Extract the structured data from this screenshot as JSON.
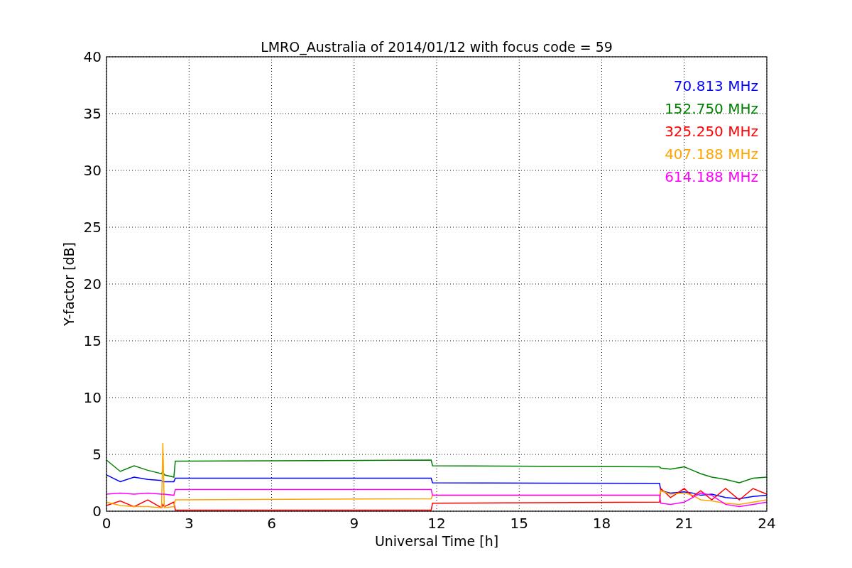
{
  "chart_data": {
    "type": "line",
    "title": "LMRO_Australia of 2014/01/12 with focus code = 59",
    "xlabel": "Universal Time [h]",
    "ylabel": "Y-factor [dB]",
    "x": [
      0,
      0.5,
      1,
      1.5,
      2,
      2.05,
      2.1,
      2.45,
      2.5,
      11.8,
      11.85,
      20.1,
      20.15,
      20.5,
      21,
      21.3,
      21.6,
      22,
      22.5,
      23,
      23.5,
      24
    ],
    "series": [
      {
        "name": "70.813 MHz",
        "color": "#0000ff",
        "values": [
          3.2,
          2.6,
          3.0,
          2.8,
          2.7,
          2.6,
          2.6,
          2.6,
          2.9,
          2.9,
          2.5,
          2.45,
          1.8,
          1.6,
          1.7,
          1.6,
          1.4,
          1.5,
          1.2,
          1.1,
          1.3,
          1.4
        ]
      },
      {
        "name": "152.750 MHz",
        "color": "#008000",
        "values": [
          4.5,
          3.5,
          4.0,
          3.6,
          3.3,
          3.5,
          3.2,
          3.0,
          4.4,
          4.5,
          4.0,
          3.9,
          3.8,
          3.7,
          3.9,
          3.6,
          3.3,
          3.0,
          2.8,
          2.5,
          2.9,
          3.0
        ]
      },
      {
        "name": "325.250 MHz",
        "color": "#ff0000",
        "values": [
          0.5,
          0.9,
          0.4,
          1.0,
          0.3,
          0.6,
          0.4,
          0.8,
          0.1,
          0.1,
          0.7,
          0.8,
          2.0,
          1.2,
          2.0,
          1.3,
          1.8,
          1.0,
          2.0,
          1.0,
          2.0,
          1.5
        ]
      },
      {
        "name": "407.188 MHz",
        "color": "#ffa500",
        "values": [
          0.8,
          0.5,
          0.4,
          0.4,
          0.3,
          6.0,
          0.3,
          0.4,
          1.0,
          1.1,
          1.4,
          1.4,
          1.8,
          1.5,
          1.6,
          1.4,
          1.0,
          0.9,
          0.7,
          0.6,
          0.8,
          1.0
        ]
      },
      {
        "name": "614.188 MHz",
        "color": "#ff00ff",
        "values": [
          1.5,
          1.6,
          1.5,
          1.6,
          1.5,
          1.5,
          1.5,
          1.4,
          1.9,
          1.9,
          1.4,
          1.4,
          0.7,
          0.6,
          0.8,
          1.2,
          1.6,
          1.4,
          0.6,
          0.4,
          0.6,
          0.8
        ]
      }
    ],
    "grid": true,
    "xlim": [
      0,
      24
    ],
    "ylim": [
      0,
      40
    ],
    "xticks": [
      0,
      3,
      6,
      9,
      12,
      15,
      18,
      21,
      24
    ],
    "yticks": [
      0,
      5,
      10,
      15,
      20,
      25,
      30,
      35,
      40
    ]
  }
}
